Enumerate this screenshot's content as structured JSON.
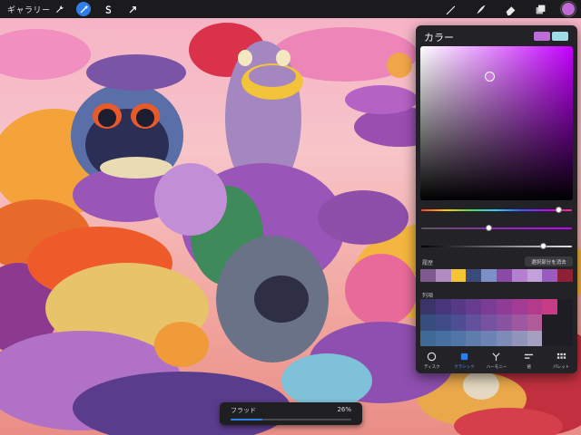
{
  "topbar": {
    "gallery_label": "ギャラリー",
    "left_icons": [
      "wrench-icon",
      "magic-wand-icon",
      "selection-s-icon",
      "transform-arrow-icon"
    ],
    "active_left_icon": "magic-wand-icon",
    "right_tools": [
      "brush-icon",
      "smudge-icon",
      "eraser-icon",
      "layers-icon"
    ],
    "current_color": "#c06ad6"
  },
  "color_panel": {
    "title": "カラー",
    "current_color": "#c06ad6",
    "previous_color": "#9edde6",
    "history_label": "履歴",
    "clear_label": "選択部分を消去",
    "history_colors": [
      "#7d5a8f",
      "#b08cc3",
      "#f2c531",
      "#3b4a7a",
      "#7c8fc8",
      "#8a4aa6",
      "#b580d1",
      "#c2a0d8",
      "#9a5ac0",
      "#8e2137"
    ],
    "palette_label": "列項",
    "palette_colors": [
      "#3a3468",
      "#47367a",
      "#573a87",
      "#673c8f",
      "#7a3d95",
      "#8e3c96",
      "#a23b93",
      "#b53a8c",
      "#c83c86",
      "#1f1d24",
      "#364d7e",
      "#3f4c88",
      "#4f4d94",
      "#62519c",
      "#7652a0",
      "#8a53a2",
      "#9f579f",
      "#b15b98",
      "#1f1d24",
      "#1f1d24",
      "#3f6a98",
      "#45709f",
      "#4f76a6",
      "#5e7dad",
      "#6d83b3",
      "#7f8bb7",
      "#9394bb",
      "#a6a0c0",
      "#1f1d24",
      "#1f1d24"
    ],
    "hue_pct": 91,
    "saturation_pct": 45,
    "brightness_pct": 81,
    "tabs": [
      {
        "label": "ディスク",
        "icon": "disc-icon"
      },
      {
        "label": "クラシック",
        "icon": "classic-icon"
      },
      {
        "label": "ハーモニー",
        "icon": "harmony-icon"
      },
      {
        "label": "値",
        "icon": "value-sliders-icon"
      },
      {
        "label": "パレット",
        "icon": "palette-grid-icon"
      }
    ],
    "active_tab": "クラシック"
  },
  "flood": {
    "label": "フラッド",
    "value_text": "26%",
    "value_pct": 26
  }
}
